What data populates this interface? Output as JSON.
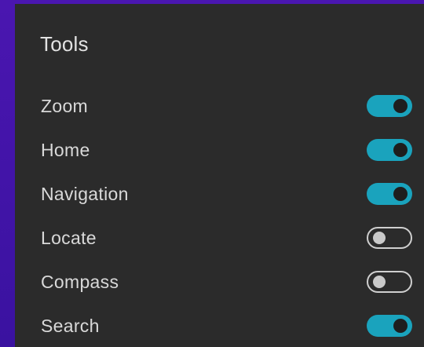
{
  "panel": {
    "title": "Tools"
  },
  "tools": [
    {
      "label": "Zoom",
      "enabled": true
    },
    {
      "label": "Home",
      "enabled": true
    },
    {
      "label": "Navigation",
      "enabled": true
    },
    {
      "label": "Locate",
      "enabled": false
    },
    {
      "label": "Compass",
      "enabled": false
    },
    {
      "label": "Search",
      "enabled": true
    }
  ],
  "colors": {
    "background": "#3d12a6",
    "panel": "#2b2b2b",
    "toggle_on": "#1aa3bd",
    "toggle_off_border": "#cfcfcf"
  }
}
